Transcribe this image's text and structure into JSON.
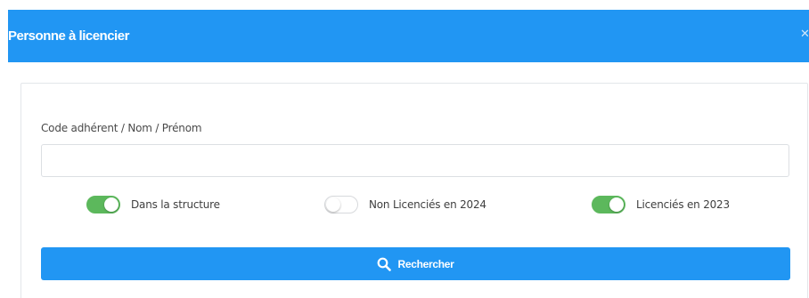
{
  "modal": {
    "title": "Personne à licencier",
    "close_icon": "close-icon",
    "header_color": "#2196f3"
  },
  "form": {
    "search_label": "Code adhérent / Nom / Prénom",
    "search_value": "",
    "search_placeholder": ""
  },
  "filters": [
    {
      "label": "Dans la structure",
      "checked": true
    },
    {
      "label": "Non Licenciés en 2024",
      "checked": false
    },
    {
      "label": "Licenciés en 2023",
      "checked": true
    }
  ],
  "actions": {
    "search_label": "Rechercher",
    "search_icon": "magnifier-icon",
    "button_color": "#2196f3",
    "toggle_on_color": "#5cb85c"
  }
}
